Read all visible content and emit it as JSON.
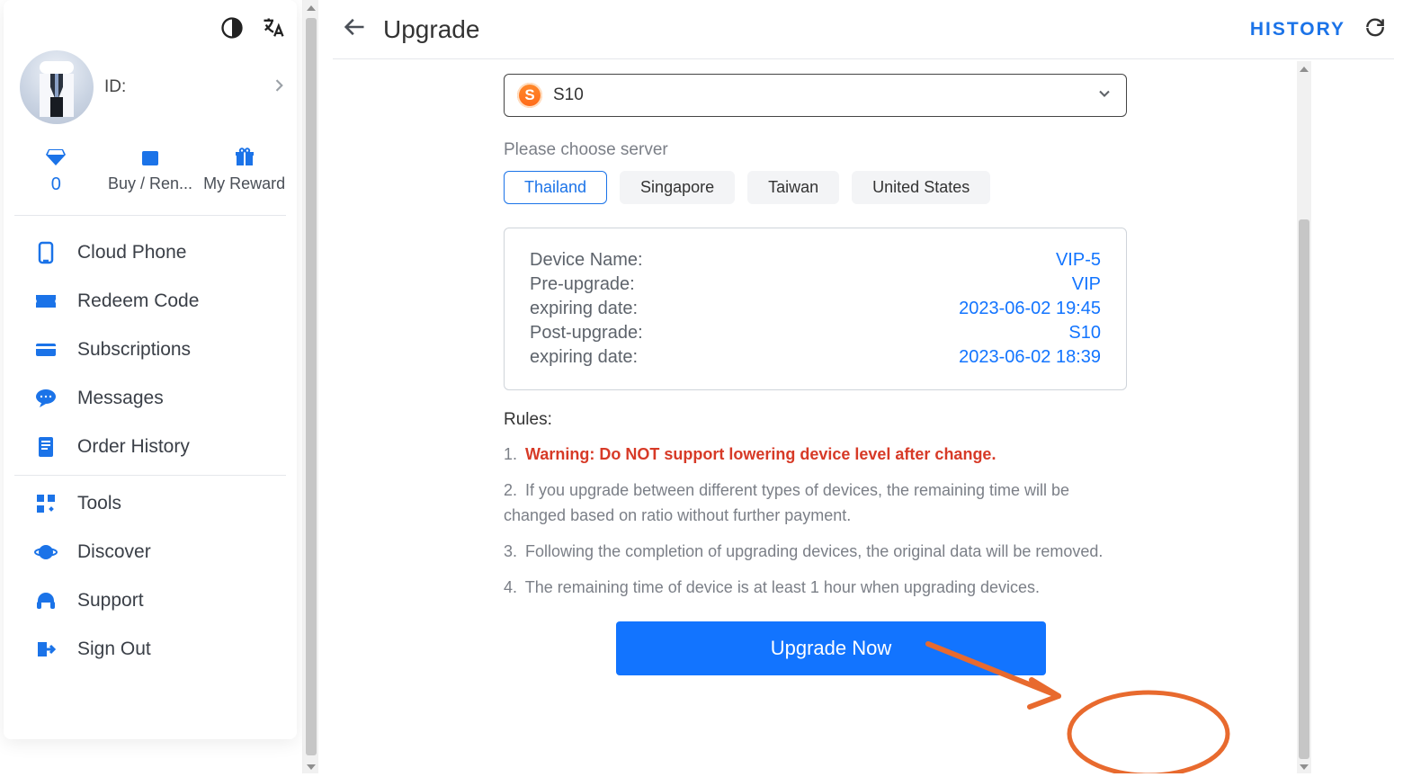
{
  "colors": {
    "primary": "#1b73e8",
    "link": "#1274ff",
    "danger": "#d73a27",
    "annotation": "#e86a2e"
  },
  "sidebar": {
    "profile": {
      "id_prefix": "ID:"
    },
    "quick": {
      "diamonds_value": "0",
      "buy_label": "Buy / Ren...",
      "reward_label": "My Reward"
    },
    "items": [
      {
        "label": "Cloud Phone"
      },
      {
        "label": "Redeem Code"
      },
      {
        "label": "Subscriptions"
      },
      {
        "label": "Messages"
      },
      {
        "label": "Order History"
      },
      {
        "label": "Tools"
      },
      {
        "label": "Discover"
      },
      {
        "label": "Support"
      },
      {
        "label": "Sign Out"
      }
    ]
  },
  "header": {
    "title": "Upgrade",
    "history": "HISTORY"
  },
  "plan_select": {
    "label": "S10"
  },
  "server": {
    "label": "Please choose server",
    "options": [
      "Thailand",
      "Singapore",
      "Taiwan",
      "United States"
    ],
    "selected_index": 0
  },
  "info": {
    "rows": [
      {
        "k": "Device Name:",
        "v": "VIP-5"
      },
      {
        "k": "Pre-upgrade:",
        "v": "VIP"
      },
      {
        "k": "expiring date:",
        "v": "2023-06-02 19:45"
      },
      {
        "k": "Post-upgrade:",
        "v": "S10"
      },
      {
        "k": "expiring date:",
        "v": "2023-06-02 18:39"
      }
    ]
  },
  "rules": {
    "title": "Rules:",
    "items": [
      {
        "n": "1.",
        "text": "Warning: Do NOT support lowering device level after change.",
        "warn": true
      },
      {
        "n": "2.",
        "text": "If you upgrade between different types of devices, the remaining time will be changed based on ratio without further payment.",
        "warn": false
      },
      {
        "n": "3.",
        "text": "Following the completion of upgrading devices, the original data will be removed.",
        "warn": false
      },
      {
        "n": "4.",
        "text": "The remaining time of device is at least 1 hour when upgrading devices.",
        "warn": false
      }
    ]
  },
  "cta_label": "Upgrade Now"
}
